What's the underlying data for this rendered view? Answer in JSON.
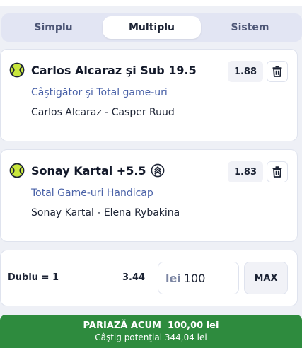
{
  "tabs": [
    {
      "label": "Simplu",
      "active": false
    },
    {
      "label": "Multiplu",
      "active": true
    },
    {
      "label": "Sistem",
      "active": false
    }
  ],
  "bets": [
    {
      "sport_icon": "tennis-ball-icon",
      "selection": "Carlos Alcaraz şi Sub 19.5",
      "odds": "1.88",
      "market": "Câştigător şi Total game-uri",
      "event": "Carlos Alcaraz - Casper Ruud",
      "boosted": false
    },
    {
      "sport_icon": "tennis-ball-icon",
      "selection": "Sonay Kartal +5.5",
      "odds": "1.83",
      "market": "Total Game-uri Handicap",
      "event": "Sonay Kartal - Elena Rybakina",
      "boosted": true
    }
  ],
  "system": {
    "label": "Dublu = 1",
    "odds": "3.44"
  },
  "stake": {
    "currency": "lei",
    "value": "100",
    "max_label": "MAX"
  },
  "place_bet": {
    "title": "PARIAZĂ ACUM  100,00 lei",
    "potential": "Câştig potenţial 344,04 lei"
  },
  "colors": {
    "accent_green": "#2e8b3e",
    "ball_yellow": "#c8e63c",
    "market_blue": "#4a62a8"
  }
}
